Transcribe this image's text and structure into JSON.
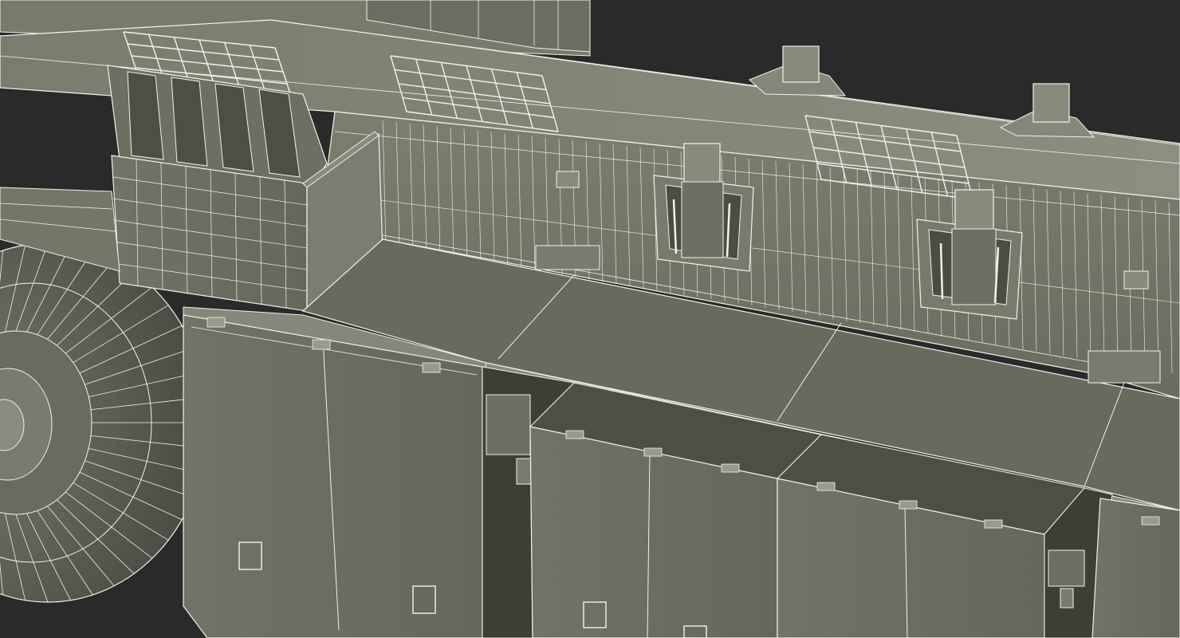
{
  "scene": {
    "subject": "wireframe-3d-crane-truck-chassis",
    "colors": {
      "background": "#2a2a2a",
      "surface_light": "#8a8a7c",
      "surface_mid": "#7a7a6c",
      "surface_dark": "#5e5e52",
      "shadow": "#3a3a32",
      "wire": "#f2f2ea"
    }
  }
}
